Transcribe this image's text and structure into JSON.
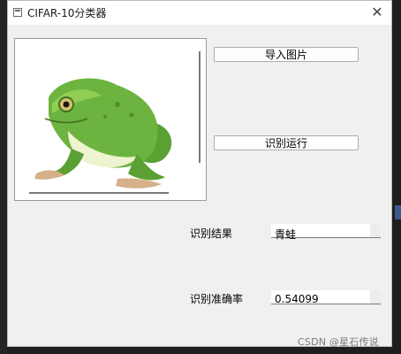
{
  "window": {
    "title": "CIFAR-10分类器",
    "icons": {
      "app": "app-icon",
      "close": "close-icon"
    },
    "close_glyph": "✕"
  },
  "image_view": {
    "subject": "frog-image"
  },
  "buttons": {
    "import_label": "导入图片",
    "run_label": "识别运行"
  },
  "result": {
    "label": "识别结果",
    "value": "青蛙"
  },
  "accuracy": {
    "label": "识别准确率",
    "value": "0.54099"
  },
  "watermark": "CSDN @星石传说",
  "colors": {
    "frog_green": "#6db33f",
    "window_bg": "#f0f0f0"
  }
}
